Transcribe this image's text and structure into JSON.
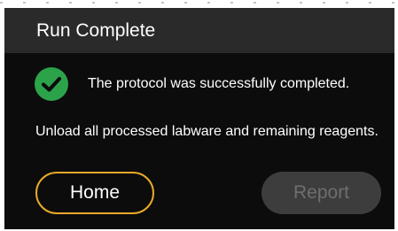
{
  "dialog": {
    "title": "Run Complete",
    "status_message": "The protocol was successfully completed.",
    "instruction": "Unload all processed labware and remaining reagents.",
    "status_icon": "check-circle-icon"
  },
  "buttons": {
    "home_label": "Home",
    "report_label": "Report",
    "report_enabled": false
  },
  "colors": {
    "success": "#2ca34a",
    "accent_outline": "#e8a92a",
    "background": "#0c0c0c",
    "header": "#2a2a2a",
    "disabled_button": "#3d3d3d",
    "disabled_text": "#6e6e6e"
  }
}
